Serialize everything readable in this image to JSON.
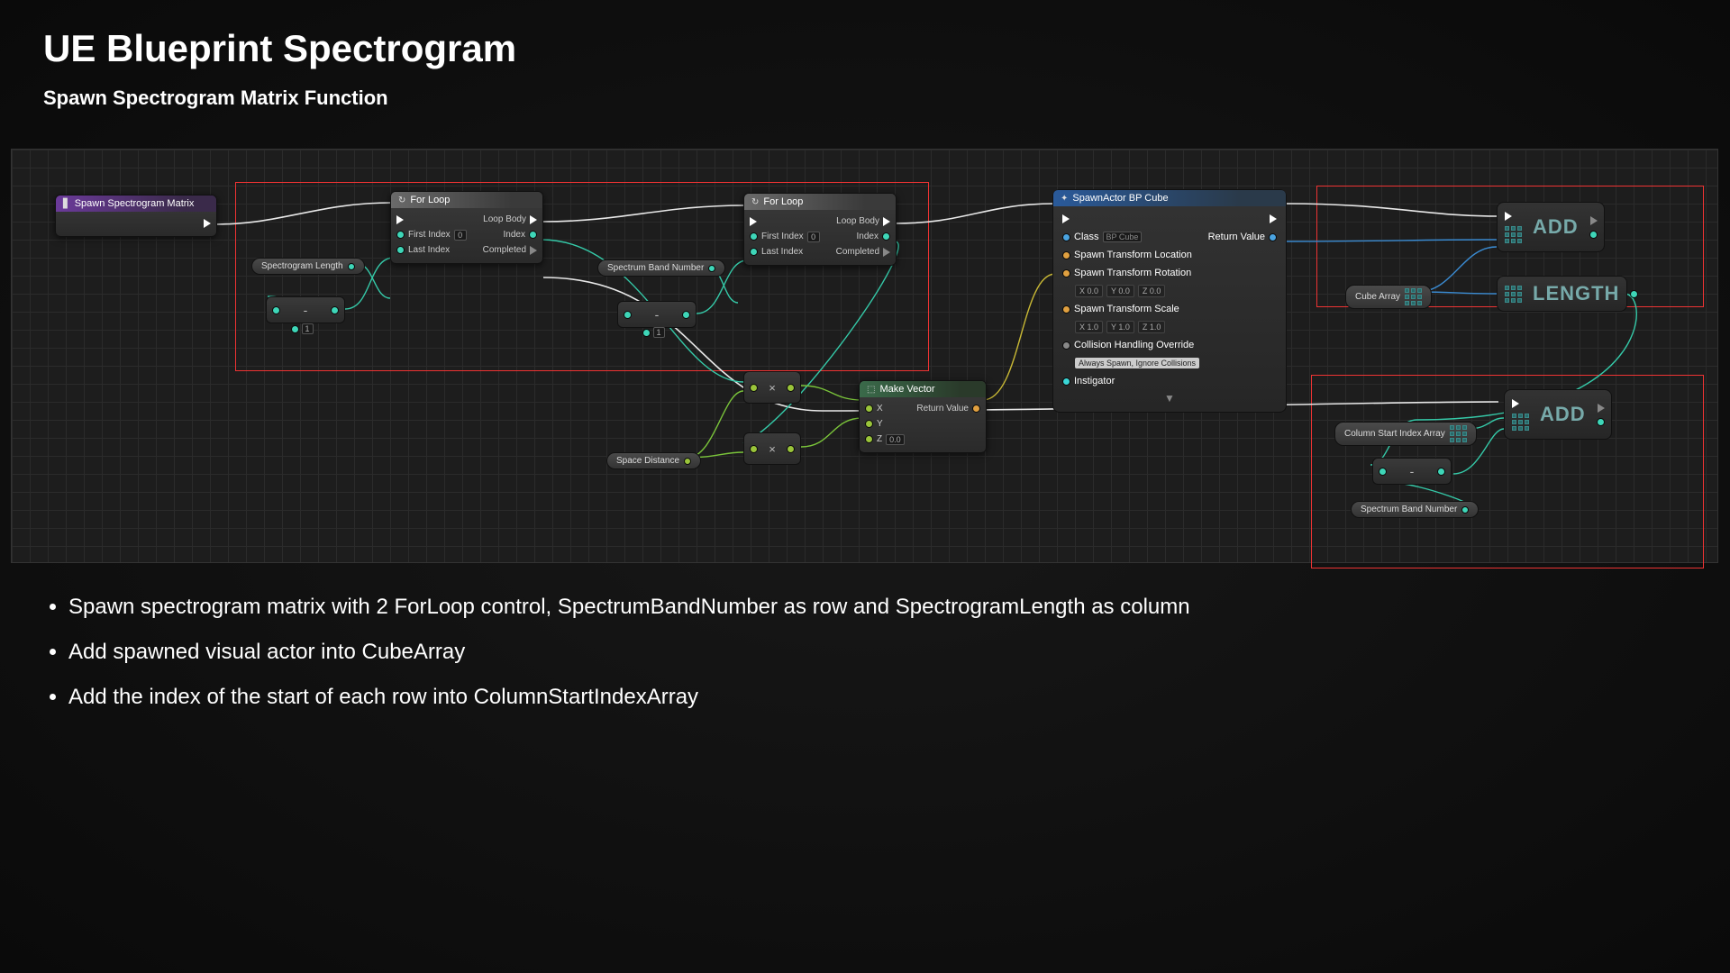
{
  "title": "UE Blueprint Spectrogram",
  "subtitle": "Spawn Spectrogram Matrix Function",
  "bullets": [
    "Spawn spectrogram matrix with 2 ForLoop control, SpectrumBandNumber as row and SpectrogramLength as column",
    "Add spawned visual actor into CubeArray",
    "Add the index of the start of each row into ColumnStartIndexArray"
  ],
  "nodes": {
    "entry": {
      "title": "Spawn Spectrogram Matrix"
    },
    "forloop": {
      "title": "For Loop",
      "first_index": "First Index",
      "last_index": "Last Index",
      "first_val": "0",
      "loop_body": "Loop Body",
      "index": "Index",
      "completed": "Completed"
    },
    "spectrogram_length": "Spectrogram Length",
    "spectrum_band_number": "Spectrum Band Number",
    "space_distance": "Space Distance",
    "minus_one": {
      "op": "-",
      "val": "1"
    },
    "multiply_op": "×",
    "make_vector": {
      "title": "Make Vector",
      "x": "X",
      "y": "Y",
      "z": "Z",
      "z_val": "0.0",
      "return": "Return Value"
    },
    "spawn_actor": {
      "title": "SpawnActor BP Cube",
      "class_label": "Class",
      "class_val": "BP Cube",
      "location": "Spawn Transform Location",
      "rotation": "Spawn Transform Rotation",
      "rotation_vals": [
        "X 0.0",
        "Y 0.0",
        "Z 0.0"
      ],
      "scale": "Spawn Transform Scale",
      "scale_vals": [
        "X 1.0",
        "Y 1.0",
        "Z 1.0"
      ],
      "collision": "Collision Handling Override",
      "collision_val": "Always Spawn, Ignore Collisions",
      "instigator": "Instigator",
      "return": "Return Value"
    },
    "cube_array": "Cube Array",
    "column_start_index_array": "Column Start Index Array",
    "add": "ADD",
    "length": "LENGTH"
  }
}
